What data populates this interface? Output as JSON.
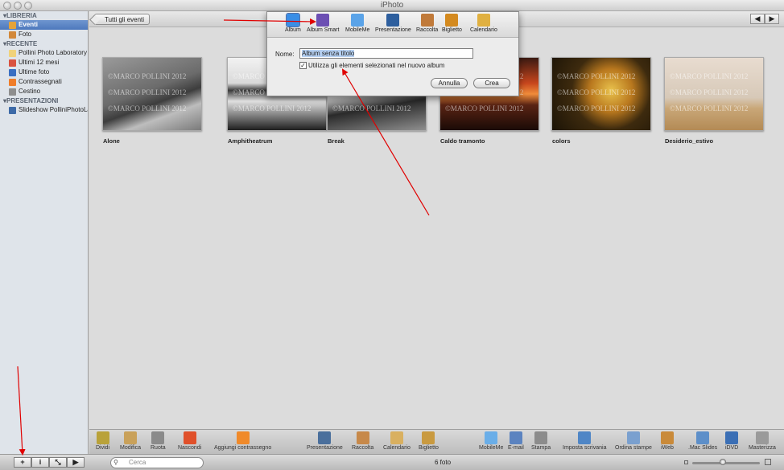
{
  "window": {
    "title": "iPhoto"
  },
  "sidebar": {
    "sections": [
      {
        "label": "LIBRERIA",
        "items": [
          {
            "label": "Eventi",
            "icon": "events-icon",
            "selected": true
          },
          {
            "label": "Foto",
            "icon": "photos-icon"
          }
        ]
      },
      {
        "label": "RECENTE",
        "items": [
          {
            "label": "Pollini Photo Laboratory",
            "icon": "event-album-icon"
          },
          {
            "label": "Ultimi 12 mesi",
            "icon": "calendar-icon"
          },
          {
            "label": "Ultime foto",
            "icon": "import-icon"
          },
          {
            "label": "Contrassegnati",
            "icon": "flag-icon"
          },
          {
            "label": "Cestino",
            "icon": "trash-icon"
          }
        ]
      },
      {
        "label": "PRESENTAZIONI",
        "items": [
          {
            "label": "Slideshow PolliniPhotoLab",
            "icon": "slideshow-icon"
          }
        ]
      }
    ]
  },
  "main": {
    "back_label": "Tutti gli eventi",
    "nav_prev": "◀",
    "nav_next": "▶",
    "watermark": "©MARCO POLLINI 2012",
    "events": [
      {
        "name": "Alone"
      },
      {
        "name": "Amphitheatrum"
      },
      {
        "name": "Break"
      },
      {
        "name": "Caldo tramonto"
      },
      {
        "name": "colors"
      },
      {
        "name": "Desiderio_estivo"
      }
    ]
  },
  "popup": {
    "tools": [
      {
        "label": "Album",
        "icon": "album-icon",
        "color": "#3a8ee6",
        "selected": true
      },
      {
        "label": "Album Smart",
        "icon": "smart-album-icon",
        "color": "#6c4fb3"
      },
      {
        "label": "MobileMe",
        "icon": "mobileme-icon",
        "color": "#5aa3e8"
      },
      {
        "label": "Presentazione",
        "icon": "slideshow-icon",
        "color": "#2e5f9e"
      },
      {
        "label": "Raccolta",
        "icon": "book-icon",
        "color": "#c07a3a"
      },
      {
        "label": "Biglietto",
        "icon": "card-icon",
        "color": "#d48a1f"
      },
      {
        "label": "Calendario",
        "icon": "calendar-icon",
        "color": "#e0b040"
      }
    ],
    "name_label": "Nome:",
    "name_value": "Album senza titolo",
    "checkbox_label": "Utilizza gli elementi selezionati nel nuovo album",
    "checkbox_checked": true,
    "checkbox_mark": "✓",
    "cancel_label": "Annulla",
    "create_label": "Crea"
  },
  "toolbar": {
    "groups": [
      {
        "label": "Dividi",
        "icon": "split-icon",
        "color": "#b9a23a"
      },
      {
        "label": "Modifica",
        "icon": "pencil-icon",
        "color": "#c9a15a"
      },
      {
        "label": "Ruota",
        "icon": "rotate-icon",
        "color": "#8a8a8a"
      },
      {
        "label": "Nascondi",
        "icon": "hide-x-icon",
        "color": "#e0502a"
      },
      {
        "label": "Aggiungi contrassegno",
        "icon": "flag-icon",
        "color": "#f08a2a"
      },
      {
        "label": "Presentazione",
        "icon": "slideshow-icon",
        "color": "#4a6f9c"
      },
      {
        "label": "Raccolta",
        "icon": "book-icon",
        "color": "#c7894a"
      },
      {
        "label": "Calendario",
        "icon": "calendar-icon",
        "color": "#d9b060"
      },
      {
        "label": "Biglietto",
        "icon": "card-icon",
        "color": "#c99a40"
      },
      {
        "label": "MobileMe",
        "icon": "mobileme-icon",
        "color": "#6aaee8"
      },
      {
        "label": "E-mail",
        "icon": "email-icon",
        "color": "#5b83c0"
      },
      {
        "label": "Stampa",
        "icon": "print-icon",
        "color": "#8c8c8c"
      },
      {
        "label": "Imposta scrivania",
        "icon": "desktop-icon",
        "color": "#4f86c6"
      },
      {
        "label": "Ordina stampe",
        "icon": "order-prints-icon",
        "color": "#7aa0cf"
      },
      {
        "label": "iWeb",
        "icon": "iweb-icon",
        "color": "#c98a3a"
      },
      {
        "label": ".Mac Slides",
        "icon": "mac-slides-icon",
        "color": "#5d8fc9"
      },
      {
        "label": "iDVD",
        "icon": "idvd-icon",
        "color": "#3b6fb5"
      },
      {
        "label": "Masterizza",
        "icon": "burn-icon",
        "color": "#9a9a9a"
      }
    ]
  },
  "statusbar": {
    "add_label": "+",
    "info_label": "i",
    "fullscreen_label": "⤡",
    "play_label": "▶",
    "search_placeholder": "Cerca",
    "photo_count": "6 foto",
    "zoom_level": 0.45
  }
}
